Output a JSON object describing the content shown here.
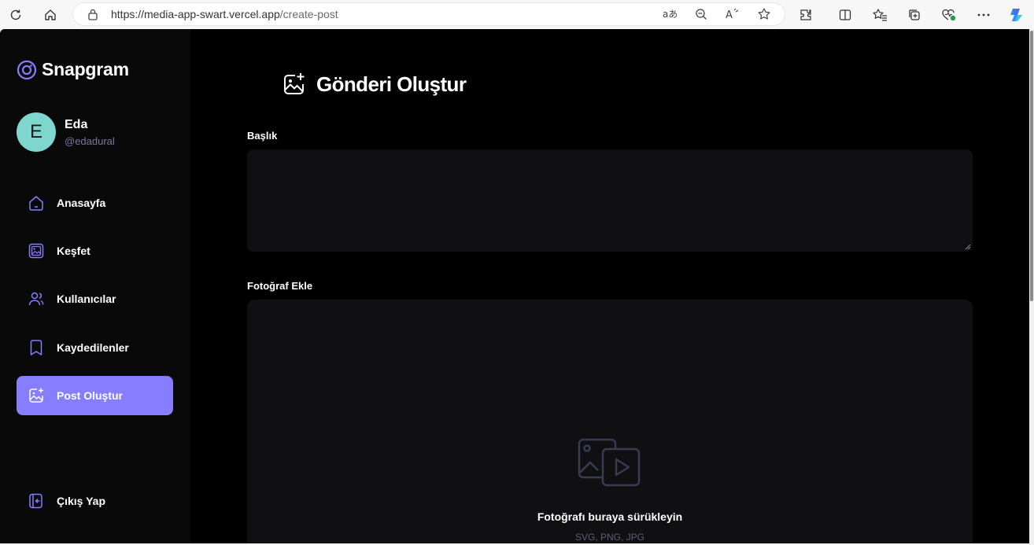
{
  "browser": {
    "url_host": "https://media-app-swart.vercel.app",
    "url_path": "/create-post",
    "icons": [
      "refresh-icon",
      "home-icon",
      "lock-icon",
      "translate-icon",
      "zoom-out-icon",
      "read-aloud-icon",
      "favorite-star-icon",
      "extensions-icon",
      "split-screen-icon",
      "favorites-icon",
      "collections-icon",
      "browser-essentials-icon",
      "more-icon",
      "copilot-icon"
    ]
  },
  "sidebar": {
    "brand": "Snapgram",
    "user": {
      "initial": "E",
      "name": "Eda",
      "handle": "@edadural"
    },
    "items": [
      {
        "label": "Anasayfa",
        "icon": "home-icon"
      },
      {
        "label": "Keşfet",
        "icon": "gallery-icon"
      },
      {
        "label": "Kullanıcılar",
        "icon": "people-icon"
      },
      {
        "label": "Kaydedilenler",
        "icon": "bookmark-icon"
      },
      {
        "label": "Post Oluştur",
        "icon": "add-post-icon",
        "active": true
      }
    ],
    "logout": "Çıkış Yap"
  },
  "main": {
    "title": "Gönderi Oluştur",
    "caption_label": "Başlık",
    "caption_value": "",
    "photo_label": "Fotoğraf Ekle",
    "drop_title": "Fotoğrafı buraya sürükleyin",
    "drop_formats": "SVG, PNG, JPG"
  },
  "colors": {
    "accent": "#877eff",
    "sidebar_bg": "#09090a",
    "input_bg": "#101012",
    "avatar_bg": "#7fd6cf",
    "muted": "#7878a3"
  }
}
